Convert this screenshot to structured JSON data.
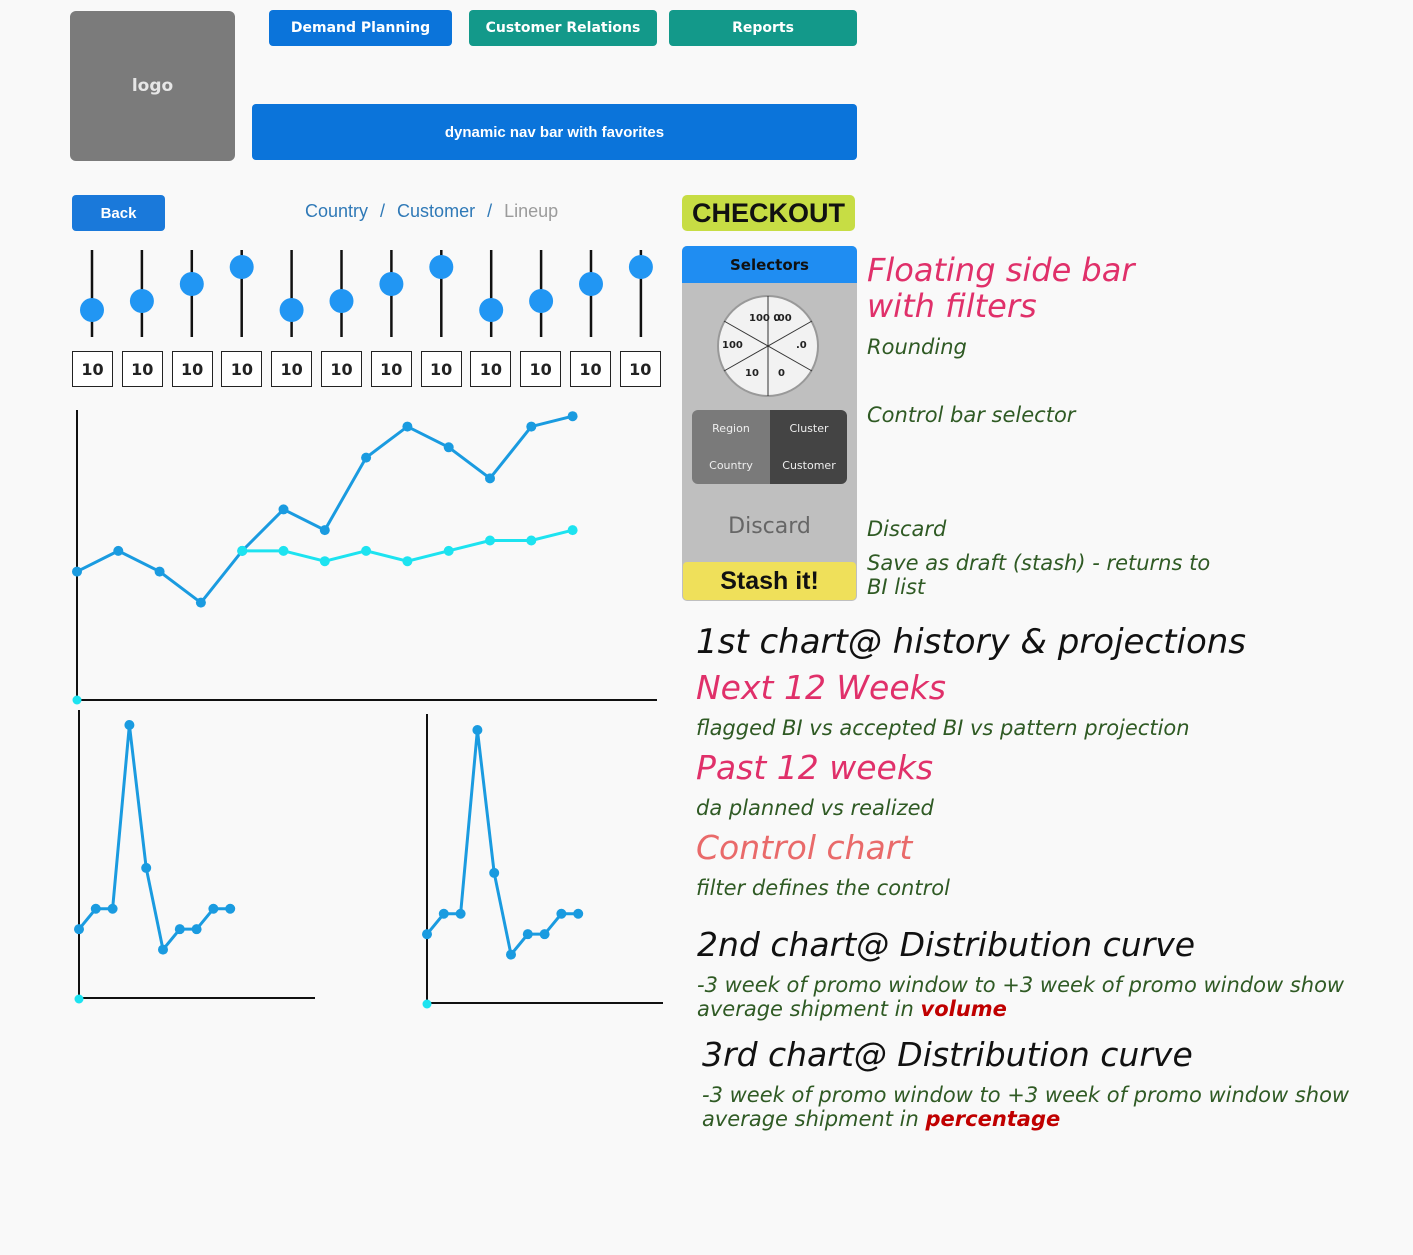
{
  "logo": {
    "label": "logo"
  },
  "nav": {
    "tabs": [
      {
        "label": "Demand Planning",
        "color": "#0b74da"
      },
      {
        "label": "Customer Relations",
        "color": "#13998a"
      },
      {
        "label": "Reports",
        "color": "#13998a"
      }
    ],
    "dynamic_bar": "dynamic nav bar with favorites"
  },
  "toolbar": {
    "back_label": "Back"
  },
  "breadcrumb": {
    "items": [
      "Country",
      "Customer",
      "Lineup"
    ],
    "separator": "/"
  },
  "checkout_label": "CHECKOUT",
  "sliders": {
    "count": 12,
    "values": [
      "10",
      "10",
      "10",
      "10",
      "10",
      "10",
      "10",
      "10",
      "10",
      "10",
      "10",
      "10"
    ],
    "accent": "#2196f3"
  },
  "panel": {
    "title": "Selectors",
    "dial_labels": [
      "100\n0",
      ".00",
      "100",
      ".0",
      "10",
      "0"
    ],
    "segments": [
      "Region",
      "Cluster",
      "Country",
      "Customer"
    ],
    "discard_label": "Discard",
    "stash_label": "Stash it!"
  },
  "annotations": {
    "floating_title_1": "Floating side bar",
    "floating_title_2": "with filters",
    "rounding": "Rounding",
    "control_bar": "Control bar selector",
    "discard": "Discard",
    "save_draft_1": "Save as draft (stash) - returns to",
    "save_draft_2": "BI list",
    "chart1_title": "1st chart@ history & projections",
    "next12": "Next 12 Weeks",
    "next12_desc": "flagged BI vs accepted BI vs pattern projection",
    "past12": "Past 12 weeks",
    "past12_desc": "da planned vs realized",
    "control_chart": "Control chart",
    "control_desc": "filter defines the control",
    "chart2_title": "2nd chart@ Distribution curve",
    "chart2_desc_1": "-3 week of promo window to +3 week of promo window show",
    "chart2_desc_2": "average shipment in",
    "chart2_emph": "volume",
    "chart3_title": "3rd chart@ Distribution curve",
    "chart3_desc_1": "-3 week of promo window to +3 week of promo window show",
    "chart3_desc_2": "average shipment in",
    "chart3_emph": "percentage"
  },
  "chart_data": [
    {
      "type": "line",
      "title": "",
      "series": [
        {
          "values": [
            62,
            72,
            62,
            47,
            72,
            92,
            82,
            117,
            132,
            122,
            107,
            132,
            137
          ],
          "color": "#1a9be0"
        },
        {
          "values": [
            null,
            null,
            null,
            null,
            72,
            72,
            67,
            72,
            67,
            72,
            77,
            77,
            82
          ],
          "color": "#1de3f0"
        }
      ],
      "ylim": [
        0,
        140
      ]
    },
    {
      "type": "line",
      "series": [
        {
          "values": [
            10,
            15,
            15,
            60,
            25,
            5,
            10,
            10,
            15,
            15
          ],
          "color": "#1a9be0"
        }
      ],
      "ylim": [
        0,
        60
      ]
    },
    {
      "type": "line",
      "series": [
        {
          "values": [
            10,
            15,
            15,
            60,
            25,
            5,
            10,
            10,
            15,
            15
          ],
          "color": "#1a9be0"
        }
      ],
      "ylim": [
        0,
        60
      ]
    }
  ]
}
